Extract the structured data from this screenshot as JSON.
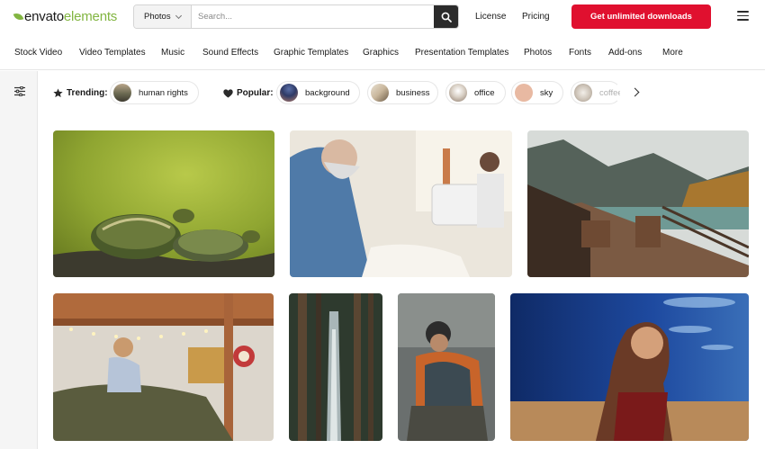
{
  "header": {
    "logo_text_a": "envato",
    "logo_text_b": "elements",
    "search_category": "Photos",
    "search_placeholder": "Search...",
    "license": "License",
    "pricing": "Pricing",
    "cta": "Get unlimited downloads"
  },
  "categories": [
    "Stock Video",
    "Video Templates",
    "Music",
    "Sound Effects",
    "Graphic Templates",
    "Graphics",
    "Presentation Templates",
    "Photos",
    "Fonts",
    "Add-ons",
    "More"
  ],
  "filters": {
    "trending_label": "Trending:",
    "popular_label": "Popular:",
    "trending": [
      "human rights"
    ],
    "popular": [
      "background",
      "business",
      "office",
      "sky",
      "coffee"
    ]
  },
  "icons": {
    "logo": "envato-leaf-icon",
    "search_button": "search-icon",
    "menu": "hamburger-menu-icon",
    "filter": "filter-sliders-icon",
    "trending": "star-icon",
    "popular": "heart-icon",
    "next": "chevron-right-icon"
  },
  "colors": {
    "brand_green": "#82b541",
    "cta_red": "#e0102f",
    "rail_bg": "#f5f5f5"
  },
  "photos": [
    "turtles",
    "tailor-at-sewing-machine",
    "lake-dock-chairs",
    "girl-in-bunk-bed",
    "forest-waterfall",
    "man-in-jacket-with-phone",
    "woman-at-bar"
  ]
}
